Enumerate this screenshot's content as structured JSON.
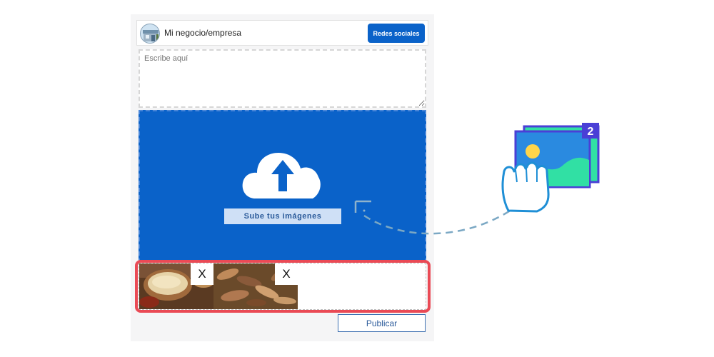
{
  "header": {
    "business_name": "Mi negocio/empresa",
    "social_button": "Redes sociales"
  },
  "composer": {
    "placeholder": "Escribe aquí"
  },
  "upload": {
    "label": "Sube tus imágenes"
  },
  "thumbnails": [
    {
      "remove_label": "X",
      "content": "quinoa-bowl-image"
    },
    {
      "remove_label": "X",
      "content": "beans-pods-image"
    }
  ],
  "actions": {
    "publish": "Publicar"
  },
  "illustration": {
    "badge_count": "2"
  },
  "colors": {
    "brand_blue": "#0a62c9",
    "highlight_red": "#ea4a55",
    "badge_purple": "#4a3fd6",
    "image_green": "#31e0a4",
    "hand_stroke": "#1f8fd6"
  }
}
